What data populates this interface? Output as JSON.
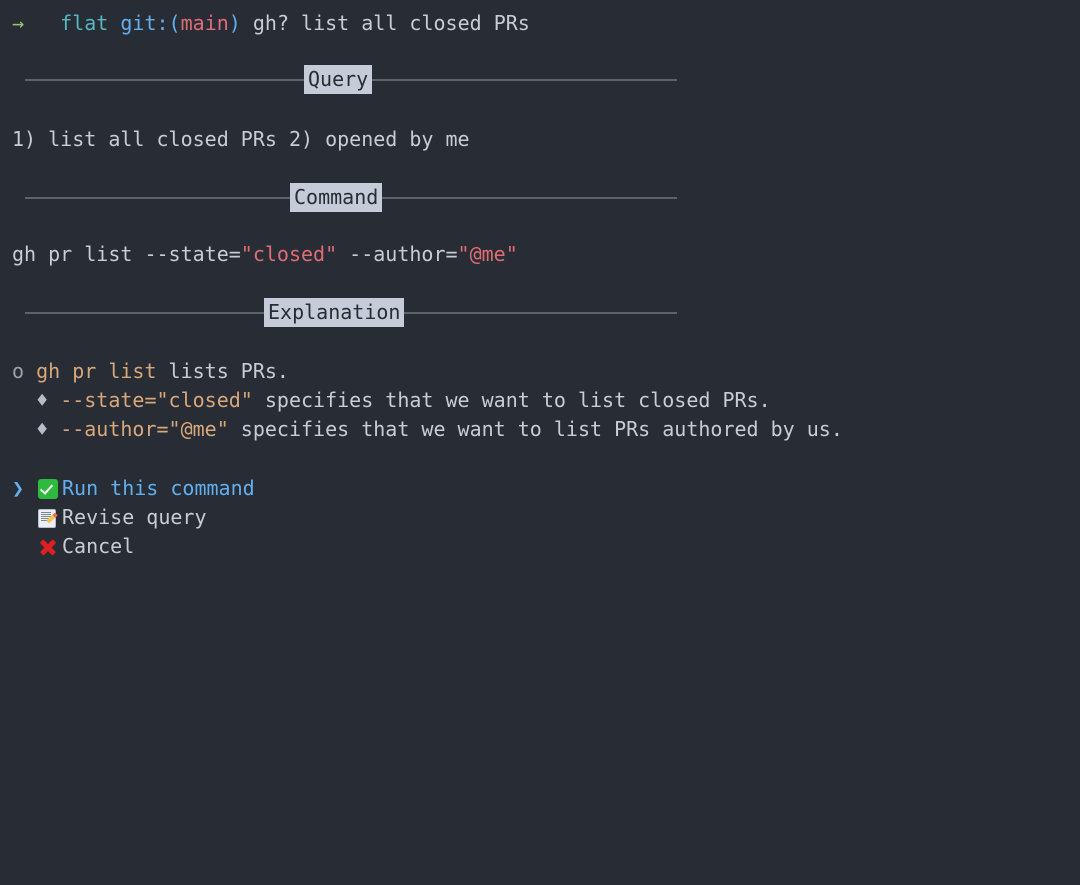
{
  "terminal": {
    "background_color": "#282c34",
    "foreground_color": "#c8ccd4"
  },
  "prompt": {
    "arrow": "→",
    "directory": "flat",
    "git_prefix": "git:(",
    "git_branch": "main",
    "git_suffix": ")",
    "command_input": "gh? list all closed PRs",
    "colors": {
      "arrow": "#98c379",
      "directory": "#56b6c2",
      "git": "#61afef",
      "branch": "#e06c75",
      "input": "#c8ccd4"
    }
  },
  "sections": {
    "query": {
      "title": "Query",
      "text": "1) list all closed PRs 2) opened by me"
    },
    "command": {
      "title": "Command",
      "prefix": "gh pr list --state=",
      "string1": "\"closed\"",
      "middle": " --author=",
      "string2": "\"@me\"",
      "full": "gh pr list --state=\"closed\" --author=\"@me\""
    },
    "explanation": {
      "title": "Explanation",
      "items": [
        {
          "bullet": "o",
          "bullet_type": "circle",
          "code": "gh pr list",
          "text": " lists PRs.",
          "indent": 0
        },
        {
          "bullet": "♦",
          "bullet_type": "diamond",
          "code": "--state=\"closed\"",
          "text": " specifies that we want to list closed PRs.",
          "indent": 1
        },
        {
          "bullet": "♦",
          "bullet_type": "diamond",
          "code": "--author=\"@me\"",
          "text": " specifies that we want to list PRs authored by us.",
          "indent": 1
        }
      ]
    }
  },
  "menu": {
    "pointer": "❯",
    "options": [
      {
        "icon": "white-check-mark-icon",
        "label": "Run this command",
        "selected": true
      },
      {
        "icon": "memo-icon",
        "label": "Revise query",
        "selected": false
      },
      {
        "icon": "cross-mark-icon",
        "label": "Cancel",
        "selected": false
      }
    ]
  }
}
